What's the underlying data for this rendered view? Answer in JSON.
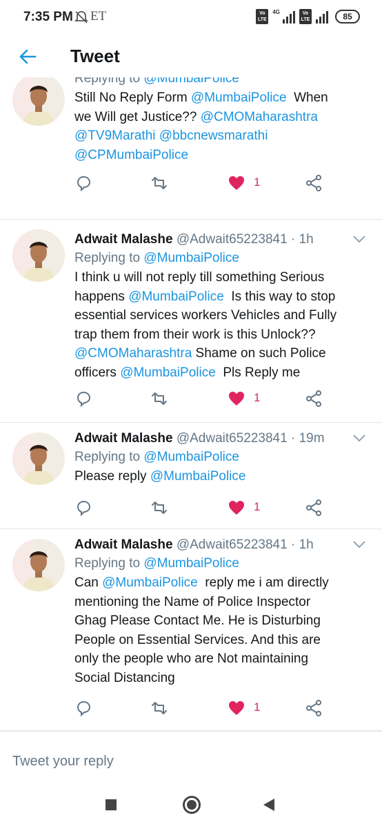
{
  "status_bar": {
    "time": "7:35 PM",
    "carrier_label": "ET",
    "network_label": "4G",
    "volte_1": "Vo\nLTE",
    "volte_2": "Vo\nLTE",
    "battery": "85",
    "icons": [
      "mute-icon",
      "signal-icon",
      "battery-icon"
    ]
  },
  "app_bar": {
    "title": "Tweet",
    "back_icon": "arrow-left-icon"
  },
  "colors": {
    "accent": "#1b95e0",
    "like": "#e0245e",
    "muted": "#657786",
    "text": "#14171a"
  },
  "tweets": [
    {
      "author": "",
      "handle": "",
      "time": "",
      "replying_prefix": "Replying to ",
      "replying_to": "@MumbaiPolice",
      "text_lines": [
        [
          {
            "t": "Still No Reply Form "
          },
          {
            "t": "@MumbaiPolice",
            "m": true
          },
          {
            "t": "  When"
          }
        ],
        [
          {
            "t": "we Will get Justice?? "
          },
          {
            "t": "@CMOMaharashtra",
            "m": true
          }
        ],
        [
          {
            "t": "@TV9Marathi",
            "m": true
          },
          {
            "t": " "
          },
          {
            "t": "@bbcnewsmarathi",
            "m": true
          }
        ],
        [
          {
            "t": "@CPMumbaiPolice",
            "m": true
          }
        ]
      ],
      "likes": "1"
    },
    {
      "author": "Adwait Malashe",
      "handle": "@Adwait65223841",
      "time": "· 1h",
      "replying_prefix": "Replying to ",
      "replying_to": "@MumbaiPolice",
      "text_lines": [
        [
          {
            "t": "I think u will not reply till something Serious"
          }
        ],
        [
          {
            "t": "happens "
          },
          {
            "t": "@MumbaiPolice",
            "m": true
          },
          {
            "t": "  Is this way to stop"
          }
        ],
        [
          {
            "t": "essential services workers Vehicles and Fully"
          }
        ],
        [
          {
            "t": "trap them from their work is this Unlock??"
          }
        ],
        [
          {
            "t": "@CMOMaharashtra",
            "m": true
          },
          {
            "t": " Shame on such Police"
          }
        ],
        [
          {
            "t": "officers "
          },
          {
            "t": "@MumbaiPolice",
            "m": true
          },
          {
            "t": "  Pls Reply me"
          }
        ]
      ],
      "likes": "1"
    },
    {
      "author": "Adwait Malashe",
      "handle": "@Adwait65223841",
      "time": "· 19m",
      "replying_prefix": "Replying to ",
      "replying_to": "@MumbaiPolice",
      "text_lines": [
        [
          {
            "t": "Please reply "
          },
          {
            "t": "@MumbaiPolice",
            "m": true
          }
        ]
      ],
      "likes": "1"
    },
    {
      "author": "Adwait Malashe",
      "handle": "@Adwait65223841",
      "time": "· 1h",
      "replying_prefix": "Replying to ",
      "replying_to": "@MumbaiPolice",
      "text_lines": [
        [
          {
            "t": "Can "
          },
          {
            "t": "@MumbaiPolice",
            "m": true
          },
          {
            "t": "  reply me i am directly"
          }
        ],
        [
          {
            "t": "mentioning the Name of Police Inspector"
          }
        ],
        [
          {
            "t": "Ghag Please Contact Me. He is Disturbing"
          }
        ],
        [
          {
            "t": "People on Essential Services. And this are"
          }
        ],
        [
          {
            "t": "only the people who are Not maintaining"
          }
        ],
        [
          {
            "t": "Social Distancing"
          }
        ]
      ],
      "likes": "1"
    }
  ],
  "reply_bar": {
    "placeholder": "Tweet your reply"
  },
  "nav_bar": {
    "icons": [
      "recents-square-icon",
      "home-circle-icon",
      "back-triangle-icon"
    ]
  }
}
